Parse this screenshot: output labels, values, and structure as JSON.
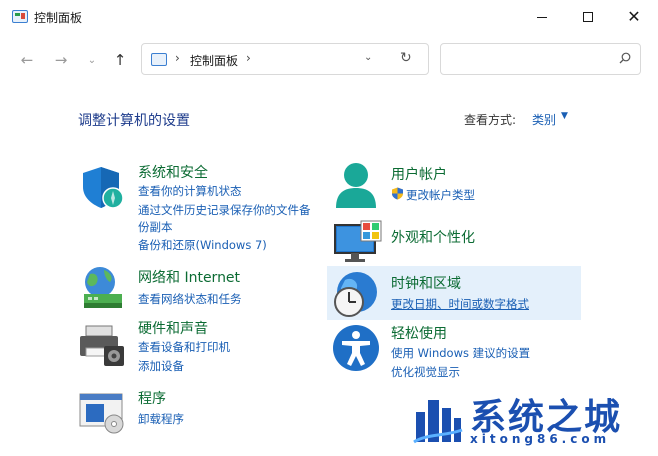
{
  "window": {
    "title": "控制面板"
  },
  "nav": {
    "back_icon": "←",
    "forward_icon": "→",
    "recent_icon": "⌄",
    "up_icon": "↑",
    "breadcrumb": "控制面板",
    "sep": "›",
    "dropdown_icon": "⌄",
    "refresh_icon": "↻",
    "search_placeholder": ""
  },
  "header": {
    "title": "调整计算机的设置",
    "view_by_label": "查看方式:",
    "view_by_value": "类别"
  },
  "categories": {
    "security": {
      "title": "系统和安全",
      "links": [
        "查看你的计算机状态",
        "通过文件历史记录保存你的文件备",
        "份副本",
        "备份和还原(Windows 7)"
      ]
    },
    "network": {
      "title": "网络和 Internet",
      "links": [
        "查看网络状态和任务"
      ]
    },
    "hardware": {
      "title": "硬件和声音",
      "links": [
        "查看设备和打印机",
        "添加设备"
      ]
    },
    "programs": {
      "title": "程序",
      "links": [
        "卸载程序"
      ]
    },
    "accounts": {
      "title": "用户帐户",
      "links": [
        "更改帐户类型"
      ]
    },
    "appearance": {
      "title": "外观和个性化",
      "links": []
    },
    "clock": {
      "title": "时钟和区域",
      "links": [
        "更改日期、时间或数字格式"
      ]
    },
    "ease": {
      "title": "轻松使用",
      "links": [
        "使用 Windows 建议的设置",
        "优化视觉显示"
      ]
    }
  },
  "watermark": {
    "text": "系统之城",
    "url": "xitong86.com"
  },
  "colors": {
    "title_green": "#0b6b33",
    "link_blue": "#1a5fb4",
    "heading_blue": "#1e3c8c",
    "highlight": "#e4f0fb"
  }
}
